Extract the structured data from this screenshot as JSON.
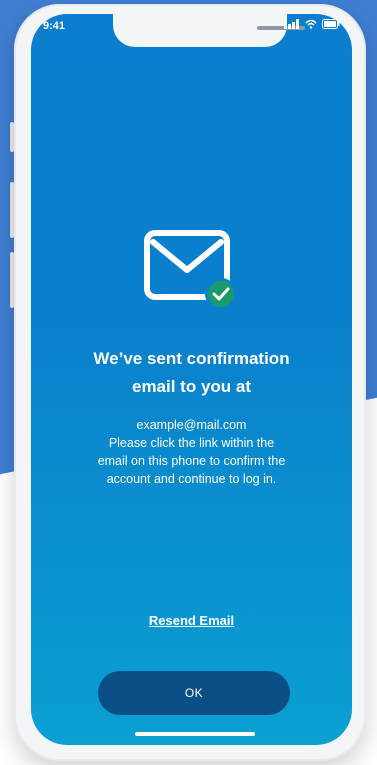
{
  "status_bar": {
    "time": "9:41",
    "icons": [
      "signal-icon",
      "wifi-icon",
      "battery-icon"
    ]
  },
  "confirmation": {
    "icon": "mail-check-icon",
    "title_line1": "We’ve sent confirmation",
    "title_line2": "email to you at",
    "email": "example@mail.com",
    "instructions_line1": "Please click the link within the",
    "instructions_line2": "email on this phone to confirm the",
    "instructions_line3": "account and continue to log in."
  },
  "actions": {
    "resend_label": "Resend Email",
    "ok_label": "OK"
  },
  "colors": {
    "background_blue": "#3f7ed1",
    "screen_gradient_top": "#0c7ecf",
    "screen_gradient_bottom": "#0aa0d2",
    "button": "#0b4f87",
    "check_badge": "#1a9a6b"
  }
}
